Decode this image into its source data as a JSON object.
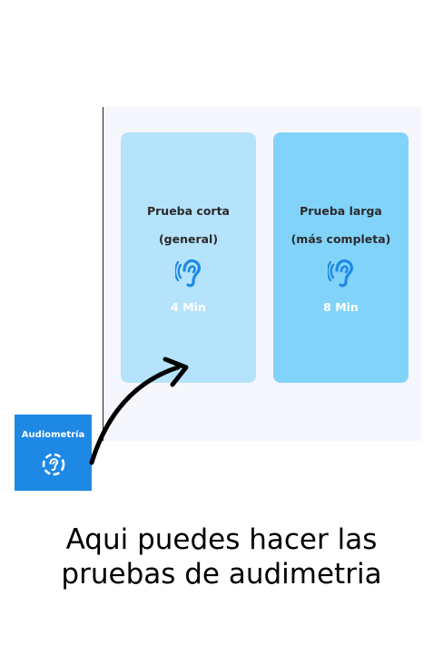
{
  "cards": [
    {
      "title": "Prueba corta",
      "subtitle": "(general)",
      "duration": "4 Min",
      "icon": "ear-icon"
    },
    {
      "title": "Prueba larga",
      "subtitle": "(más completa)",
      "duration": "8 Min",
      "icon": "ear-icon"
    }
  ],
  "tile": {
    "label": "Audiometría",
    "icon": "hearing-test-icon"
  },
  "caption": {
    "line1": "Aqui puedes hacer las",
    "line2": "pruebas de audimetria"
  },
  "colors": {
    "panel_bg": "#f6f7fd",
    "card_short_bg": "#b4e3fb",
    "card_long_bg": "#82d3fa",
    "icon_blue": "#1e88e5",
    "tile_bg": "#1e88e5"
  }
}
